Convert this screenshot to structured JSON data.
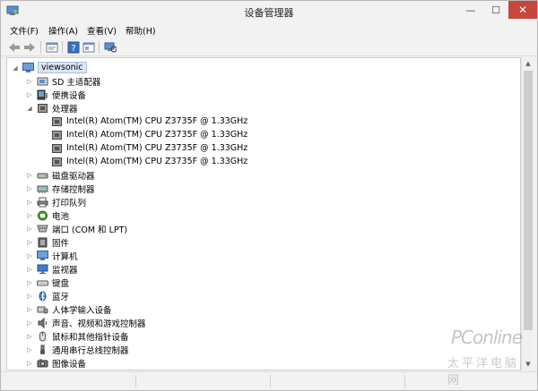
{
  "window": {
    "title": "设备管理器",
    "min": "—",
    "max": "☐",
    "close": "✕"
  },
  "menu": [
    "文件(F)",
    "操作(A)",
    "查看(V)",
    "帮助(H)"
  ],
  "toolbar": [
    "back",
    "forward",
    "properties",
    "help",
    "show-hide",
    "scan-hardware"
  ],
  "root": {
    "label": "viewsonic",
    "icon": "computer-icon"
  },
  "categories": [
    {
      "label": "SD 主适配器",
      "icon": "sd-adapter-icon",
      "expanded": false
    },
    {
      "label": "便携设备",
      "icon": "portable-device-icon",
      "expanded": false
    },
    {
      "label": "处理器",
      "icon": "processor-icon",
      "expanded": true,
      "children": [
        "Intel(R) Atom(TM) CPU  Z3735F @ 1.33GHz",
        "Intel(R) Atom(TM) CPU  Z3735F @ 1.33GHz",
        "Intel(R) Atom(TM) CPU  Z3735F @ 1.33GHz",
        "Intel(R) Atom(TM) CPU  Z3735F @ 1.33GHz"
      ]
    },
    {
      "label": "磁盘驱动器",
      "icon": "disk-drive-icon",
      "expanded": false
    },
    {
      "label": "存储控制器",
      "icon": "storage-controller-icon",
      "expanded": false
    },
    {
      "label": "打印队列",
      "icon": "printer-icon",
      "expanded": false
    },
    {
      "label": "电池",
      "icon": "battery-icon",
      "expanded": false
    },
    {
      "label": "端口 (COM 和 LPT)",
      "icon": "port-icon",
      "expanded": false
    },
    {
      "label": "固件",
      "icon": "firmware-icon",
      "expanded": false
    },
    {
      "label": "计算机",
      "icon": "computer-icon",
      "expanded": false
    },
    {
      "label": "监视器",
      "icon": "monitor-icon",
      "expanded": false
    },
    {
      "label": "键盘",
      "icon": "keyboard-icon",
      "expanded": false
    },
    {
      "label": "蓝牙",
      "icon": "bluetooth-icon",
      "expanded": false
    },
    {
      "label": "人体学输入设备",
      "icon": "hid-icon",
      "expanded": false
    },
    {
      "label": "声音、视频和游戏控制器",
      "icon": "sound-icon",
      "expanded": false
    },
    {
      "label": "鼠标和其他指针设备",
      "icon": "mouse-icon",
      "expanded": false
    },
    {
      "label": "通用串行总线控制器",
      "icon": "usb-icon",
      "expanded": false
    },
    {
      "label": "图像设备",
      "icon": "camera-icon",
      "expanded": false
    }
  ],
  "watermark": {
    "brand": "PConline",
    "sub": "太平洋电脑网"
  },
  "colors": {
    "selection": "#dde6f3",
    "close_button": "#c7463d"
  }
}
